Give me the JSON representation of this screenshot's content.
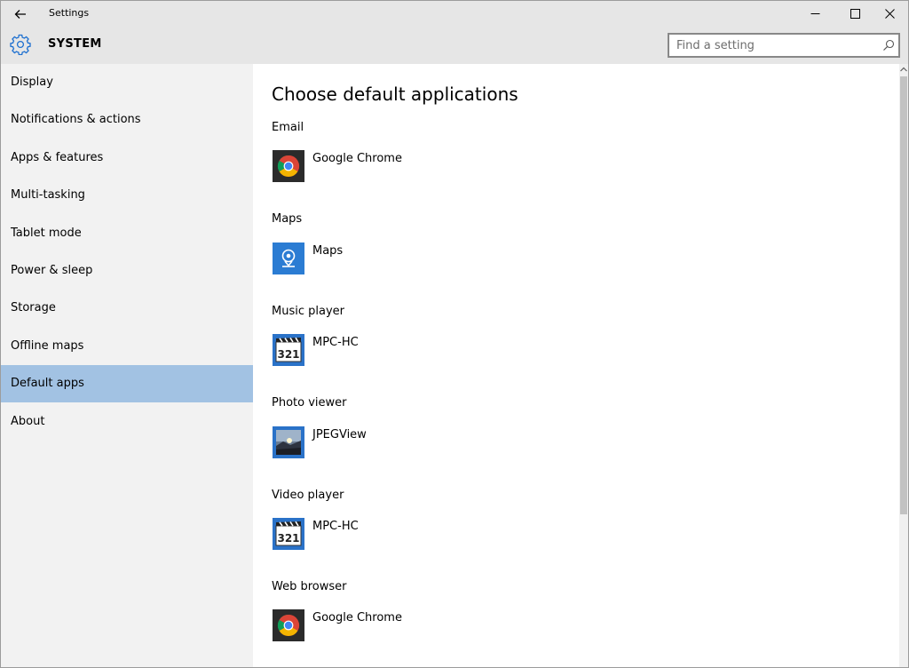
{
  "window": {
    "title": "Settings"
  },
  "header": {
    "title": "SYSTEM",
    "search_placeholder": "Find a setting"
  },
  "sidebar": {
    "items": [
      {
        "label": "Display"
      },
      {
        "label": "Notifications & actions"
      },
      {
        "label": "Apps & features"
      },
      {
        "label": "Multi-tasking"
      },
      {
        "label": "Tablet mode"
      },
      {
        "label": "Power & sleep"
      },
      {
        "label": "Storage"
      },
      {
        "label": "Offline maps"
      },
      {
        "label": "Default apps",
        "active": true
      },
      {
        "label": "About"
      }
    ]
  },
  "main": {
    "title": "Choose default applications",
    "sections": [
      {
        "label": "Email",
        "app": "Google Chrome",
        "icon": "chrome-icon"
      },
      {
        "label": "Maps",
        "app": "Maps",
        "icon": "maps-icon"
      },
      {
        "label": "Music player",
        "app": "MPC-HC",
        "icon": "mpc-hc-icon"
      },
      {
        "label": "Photo viewer",
        "app": "JPEGView",
        "icon": "jpegview-icon"
      },
      {
        "label": "Video player",
        "app": "MPC-HC",
        "icon": "mpc-hc-icon"
      },
      {
        "label": "Web browser",
        "app": "Google Chrome",
        "icon": "chrome-icon"
      }
    ]
  },
  "colors": {
    "titlebar_bg": "#e6e6e6",
    "sidebar_bg": "#f2f2f2",
    "active_item_bg": "#a2c2e3",
    "accent": "#1e70d0",
    "scroll_thumb": "#c2c2c2"
  }
}
